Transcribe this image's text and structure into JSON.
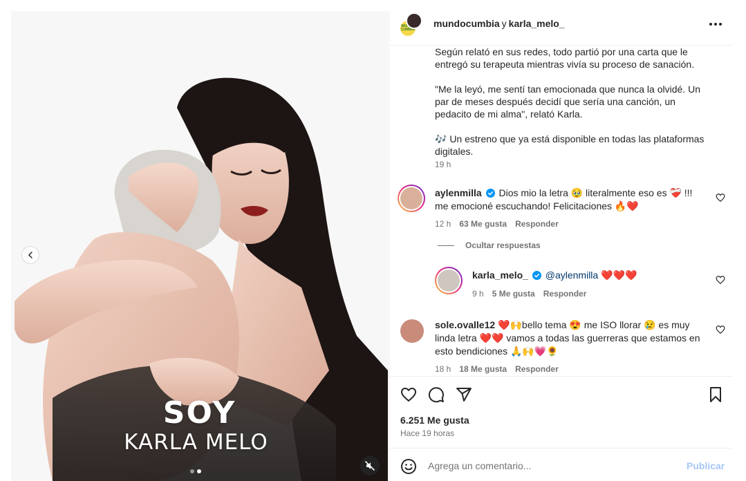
{
  "post": {
    "author_primary": "mundocumbia",
    "author_joiner": "y",
    "author_secondary": "karla_melo_",
    "logo_text": "MUNDO CUMBIA",
    "more_icon": "more-horizontal-icon"
  },
  "media": {
    "overlay_line1": "SOY",
    "overlay_line2": "KARLA MELO",
    "slide_count": 2,
    "active_slide": 2,
    "muted": true
  },
  "caption": {
    "paragraphs": [
      "Según relató en sus redes, todo partió por una carta que le entregó su terapeuta mientras vivía su proceso de sanación.",
      "\"Me la leyó, me sentí tan emocionada que nunca la olvidé. Un par de meses después decidí que sería una canción, un pedacito de mi alma\", relató Karla.",
      "🎶 Un estreno que ya está disponible en todas las plataformas digitales."
    ],
    "time": "19 h"
  },
  "comments": [
    {
      "user": "aylenmilla",
      "verified": true,
      "text": "Dios mio la letra 🥹 literalmente eso es ❤️‍🩹 !!! me emocioné escuchando! Felicitaciones 🔥❤️",
      "time": "12 h",
      "likes": "63 Me gusta",
      "reply_label": "Responder"
    },
    {
      "user": "sole.ovalle12",
      "verified": false,
      "text": "❤️🙌bello tema 😍 me ISO llorar 😢 es muy linda letra ❤️❤️ vamos a todas las guerreras que estamos en esto bendiciones 🙏🙌💗🌻",
      "time": "18 h",
      "likes": "18 Me gusta",
      "reply_label": "Responder"
    }
  ],
  "hide_replies": "Ocultar respuestas",
  "reply": {
    "user": "karla_melo_",
    "verified": true,
    "mention": "@aylenmilla",
    "text": " ❤️❤️❤️",
    "time": "9 h",
    "likes": "5 Me gusta",
    "reply_label": "Responder"
  },
  "actions": {
    "likes": "6.251 Me gusta",
    "time_ago": "Hace 19 horas"
  },
  "composer": {
    "placeholder": "Agrega un comentario...",
    "publish_label": "Publicar"
  },
  "colors": {
    "accent": "#0095f6",
    "publish_disabled": "#a6c8f5",
    "secondary_text": "#737373",
    "verified": "#0095f6"
  }
}
